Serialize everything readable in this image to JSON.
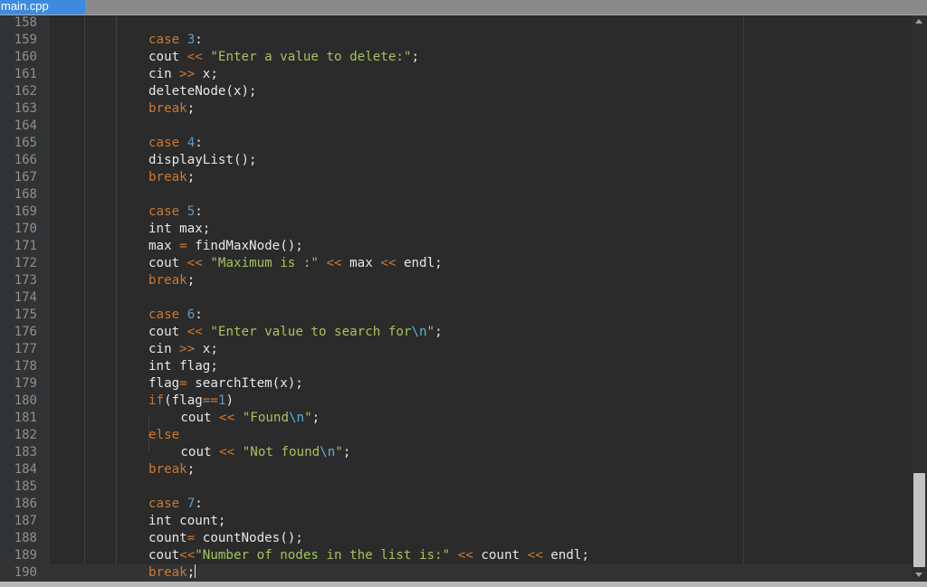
{
  "tab": {
    "filename": "main.cpp"
  },
  "editor": {
    "cursor_line": 190,
    "lines": [
      {
        "n": "158",
        "tokens": []
      },
      {
        "n": "159",
        "tokens": [
          {
            "t": "case ",
            "c": "kw"
          },
          {
            "t": "3",
            "c": "num"
          },
          {
            "t": ":",
            "c": ""
          }
        ]
      },
      {
        "n": "160",
        "tokens": [
          {
            "t": "cout ",
            "c": ""
          },
          {
            "t": "<<",
            "c": "op"
          },
          {
            "t": " ",
            "c": ""
          },
          {
            "t": "\"Enter a value to delete:\"",
            "c": "str"
          },
          {
            "t": ";",
            "c": ""
          }
        ]
      },
      {
        "n": "161",
        "tokens": [
          {
            "t": "cin ",
            "c": ""
          },
          {
            "t": ">>",
            "c": "op"
          },
          {
            "t": " x;",
            "c": ""
          }
        ]
      },
      {
        "n": "162",
        "tokens": [
          {
            "t": "deleteNode(x);",
            "c": ""
          }
        ]
      },
      {
        "n": "163",
        "tokens": [
          {
            "t": "break",
            "c": "kw"
          },
          {
            "t": ";",
            "c": ""
          }
        ]
      },
      {
        "n": "164",
        "tokens": []
      },
      {
        "n": "165",
        "tokens": [
          {
            "t": "case ",
            "c": "kw"
          },
          {
            "t": "4",
            "c": "num"
          },
          {
            "t": ":",
            "c": ""
          }
        ]
      },
      {
        "n": "166",
        "tokens": [
          {
            "t": "displayList();",
            "c": ""
          }
        ]
      },
      {
        "n": "167",
        "tokens": [
          {
            "t": "break",
            "c": "kw"
          },
          {
            "t": ";",
            "c": ""
          }
        ]
      },
      {
        "n": "168",
        "tokens": []
      },
      {
        "n": "169",
        "tokens": [
          {
            "t": "case ",
            "c": "kw"
          },
          {
            "t": "5",
            "c": "num"
          },
          {
            "t": ":",
            "c": ""
          }
        ]
      },
      {
        "n": "170",
        "tokens": [
          {
            "t": "int max;",
            "c": ""
          }
        ]
      },
      {
        "n": "171",
        "tokens": [
          {
            "t": "max ",
            "c": ""
          },
          {
            "t": "=",
            "c": "op"
          },
          {
            "t": " findMaxNode();",
            "c": ""
          }
        ]
      },
      {
        "n": "172",
        "tokens": [
          {
            "t": "cout ",
            "c": ""
          },
          {
            "t": "<<",
            "c": "op"
          },
          {
            "t": " ",
            "c": ""
          },
          {
            "t": "\"Maximum is :\"",
            "c": "str"
          },
          {
            "t": " ",
            "c": ""
          },
          {
            "t": "<<",
            "c": "op"
          },
          {
            "t": " max ",
            "c": ""
          },
          {
            "t": "<<",
            "c": "op"
          },
          {
            "t": " endl;",
            "c": ""
          }
        ]
      },
      {
        "n": "173",
        "tokens": [
          {
            "t": "break",
            "c": "kw"
          },
          {
            "t": ";",
            "c": ""
          }
        ]
      },
      {
        "n": "174",
        "tokens": []
      },
      {
        "n": "175",
        "tokens": [
          {
            "t": "case ",
            "c": "kw"
          },
          {
            "t": "6",
            "c": "num"
          },
          {
            "t": ":",
            "c": ""
          }
        ]
      },
      {
        "n": "176",
        "tokens": [
          {
            "t": "cout ",
            "c": ""
          },
          {
            "t": "<<",
            "c": "op"
          },
          {
            "t": " ",
            "c": ""
          },
          {
            "t": "\"Enter value to search for",
            "c": "str"
          },
          {
            "t": "\\n",
            "c": "esc"
          },
          {
            "t": "\"",
            "c": "str"
          },
          {
            "t": ";",
            "c": ""
          }
        ]
      },
      {
        "n": "177",
        "tokens": [
          {
            "t": "cin ",
            "c": ""
          },
          {
            "t": ">>",
            "c": "op"
          },
          {
            "t": " x;",
            "c": ""
          }
        ]
      },
      {
        "n": "178",
        "tokens": [
          {
            "t": "int flag;",
            "c": ""
          }
        ]
      },
      {
        "n": "179",
        "tokens": [
          {
            "t": "flag",
            "c": ""
          },
          {
            "t": "=",
            "c": "op"
          },
          {
            "t": " searchItem(x);",
            "c": ""
          }
        ]
      },
      {
        "n": "180",
        "tokens": [
          {
            "t": "if",
            "c": "kw"
          },
          {
            "t": "(flag",
            "c": ""
          },
          {
            "t": "==",
            "c": "op"
          },
          {
            "t": "1",
            "c": "num"
          },
          {
            "t": ")",
            "c": ""
          }
        ]
      },
      {
        "n": "181",
        "indent": 1,
        "tokens": [
          {
            "t": "cout ",
            "c": ""
          },
          {
            "t": "<<",
            "c": "op"
          },
          {
            "t": " ",
            "c": ""
          },
          {
            "t": "\"Found",
            "c": "str"
          },
          {
            "t": "\\n",
            "c": "esc"
          },
          {
            "t": "\"",
            "c": "str"
          },
          {
            "t": ";",
            "c": ""
          }
        ]
      },
      {
        "n": "182",
        "tokens": [
          {
            "t": "else",
            "c": "kw"
          }
        ]
      },
      {
        "n": "183",
        "indent": 1,
        "tokens": [
          {
            "t": "cout ",
            "c": ""
          },
          {
            "t": "<<",
            "c": "op"
          },
          {
            "t": " ",
            "c": ""
          },
          {
            "t": "\"Not found",
            "c": "str"
          },
          {
            "t": "\\n",
            "c": "esc"
          },
          {
            "t": "\"",
            "c": "str"
          },
          {
            "t": ";",
            "c": ""
          }
        ]
      },
      {
        "n": "184",
        "tokens": [
          {
            "t": "break",
            "c": "kw"
          },
          {
            "t": ";",
            "c": ""
          }
        ]
      },
      {
        "n": "185",
        "tokens": []
      },
      {
        "n": "186",
        "tokens": [
          {
            "t": "case ",
            "c": "kw"
          },
          {
            "t": "7",
            "c": "num"
          },
          {
            "t": ":",
            "c": ""
          }
        ]
      },
      {
        "n": "187",
        "tokens": [
          {
            "t": "int count;",
            "c": ""
          }
        ]
      },
      {
        "n": "188",
        "tokens": [
          {
            "t": "count",
            "c": ""
          },
          {
            "t": "=",
            "c": "op"
          },
          {
            "t": " countNodes();",
            "c": ""
          }
        ]
      },
      {
        "n": "189",
        "tokens": [
          {
            "t": "cout",
            "c": ""
          },
          {
            "t": "<<",
            "c": "op"
          },
          {
            "t": "\"Number of nodes in the list is:\"",
            "c": "str"
          },
          {
            "t": " ",
            "c": ""
          },
          {
            "t": "<<",
            "c": "op"
          },
          {
            "t": " count ",
            "c": ""
          },
          {
            "t": "<<",
            "c": "op"
          },
          {
            "t": " endl;",
            "c": ""
          }
        ]
      },
      {
        "n": "190",
        "tokens": [
          {
            "t": "break",
            "c": "kw"
          },
          {
            "t": ";",
            "c": ""
          }
        ]
      }
    ]
  },
  "scrollbar": {
    "up_icon": "arrow-up-icon",
    "down_icon": "arrow-down-icon"
  },
  "colors": {
    "background": "#2b2b2b",
    "keyword": "#cc7832",
    "number": "#6897bb",
    "string": "#a5c25c",
    "escape": "#55b5db",
    "text": "#e6e6e6",
    "tab_active": "#3c8be0"
  }
}
